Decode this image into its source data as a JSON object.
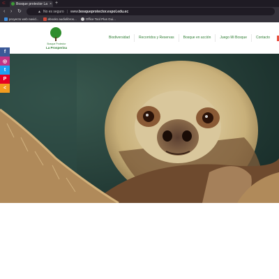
{
  "browser": {
    "tab_title": "Bosque protector La Prosperina",
    "tab_close": "×",
    "new_tab": "+",
    "security_label": "No es seguro",
    "url_prefix": "www.",
    "url_host": "bosqueprotector.espol.edu.ec",
    "bookmarks": [
      {
        "label": "proyecto web navid...",
        "icon_color": "#3d8ee0"
      },
      {
        "label": "ebooks audiolibros...",
        "icon_color": "#d04a3a"
      },
      {
        "label": "Office Tool Plus Gui...",
        "icon_color": "#cfcfcf"
      }
    ]
  },
  "site": {
    "logo_line1": "Bosque Protector",
    "logo_line2": "La Prosperina",
    "nav": [
      "Biodiversidad",
      "Recorridos y Reservas",
      "Bosque en acción",
      "Juego Mi Bosque",
      "Contacto"
    ],
    "brand_color": "#2e7d32"
  },
  "social": [
    {
      "icon": "facebook-icon",
      "glyph": "f",
      "color": "#3b5998"
    },
    {
      "icon": "instagram-icon",
      "glyph": "◎",
      "color": "#c13584"
    },
    {
      "icon": "twitter-icon",
      "glyph": "t",
      "color": "#1da1f2"
    },
    {
      "icon": "pinterest-icon",
      "glyph": "P",
      "color": "#e60023"
    },
    {
      "icon": "share-icon",
      "glyph": "<",
      "color": "#f29c1f"
    }
  ],
  "hero": {
    "subject": "two-toed sloth resting on burlap"
  }
}
